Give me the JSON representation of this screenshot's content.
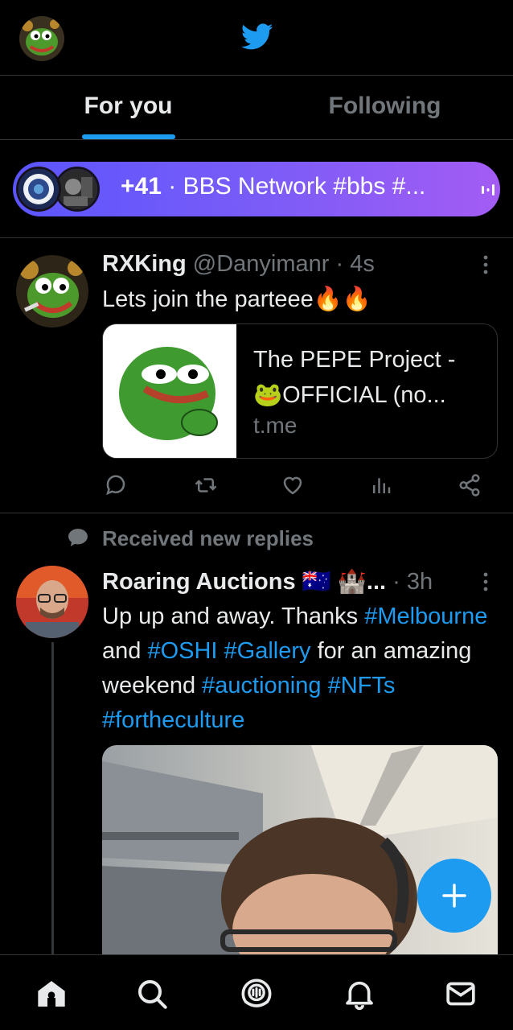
{
  "tabs": [
    {
      "label": "For you",
      "active": true
    },
    {
      "label": "Following",
      "active": false
    }
  ],
  "spaces": {
    "count": "+41",
    "separator": " · ",
    "title": "BBS Network  #bbs #..."
  },
  "tweets": [
    {
      "name": "RXKing",
      "handle": "@Danyimanr",
      "time": " · 4s",
      "text": "Lets join the parteee🔥🔥",
      "card": {
        "title": "The PEPE Project - 🐸OFFICIAL (no...",
        "domain": "t.me"
      }
    },
    {
      "context": "Received new replies",
      "name": "Roaring Auctions 🇦🇺 🏰...",
      "time": " · 3h",
      "text_parts": [
        {
          "text": "Up up and away. Thanks ",
          "hashtag": false
        },
        {
          "text": "#Melbourne",
          "hashtag": true
        },
        {
          "text": " and ",
          "hashtag": false
        },
        {
          "text": "#OSHI",
          "hashtag": true
        },
        {
          "text": " ",
          "hashtag": false
        },
        {
          "text": "#Gallery",
          "hashtag": true
        },
        {
          "text": " for an amazing weekend ",
          "hashtag": false
        },
        {
          "text": "#auctioning",
          "hashtag": true
        },
        {
          "text": " ",
          "hashtag": false
        },
        {
          "text": "#NFTs",
          "hashtag": true
        },
        {
          "text": " ",
          "hashtag": false
        },
        {
          "text": "#fortheculture",
          "hashtag": true
        }
      ]
    }
  ],
  "icons": {
    "logo": "twitter-bird-icon",
    "reply": "reply-icon",
    "retweet": "retweet-icon",
    "like": "heart-icon",
    "views": "views-icon",
    "share": "share-icon",
    "compose": "plus-icon",
    "nav": [
      "home-icon",
      "search-icon",
      "spaces-icon",
      "notifications-icon",
      "messages-icon"
    ]
  },
  "colors": {
    "accent": "#1d9bf0",
    "background": "#000000",
    "text": "#e7e9ea",
    "secondary": "#71767b",
    "spaces_gradient": [
      "#5b55ff",
      "#a35cf4"
    ]
  }
}
